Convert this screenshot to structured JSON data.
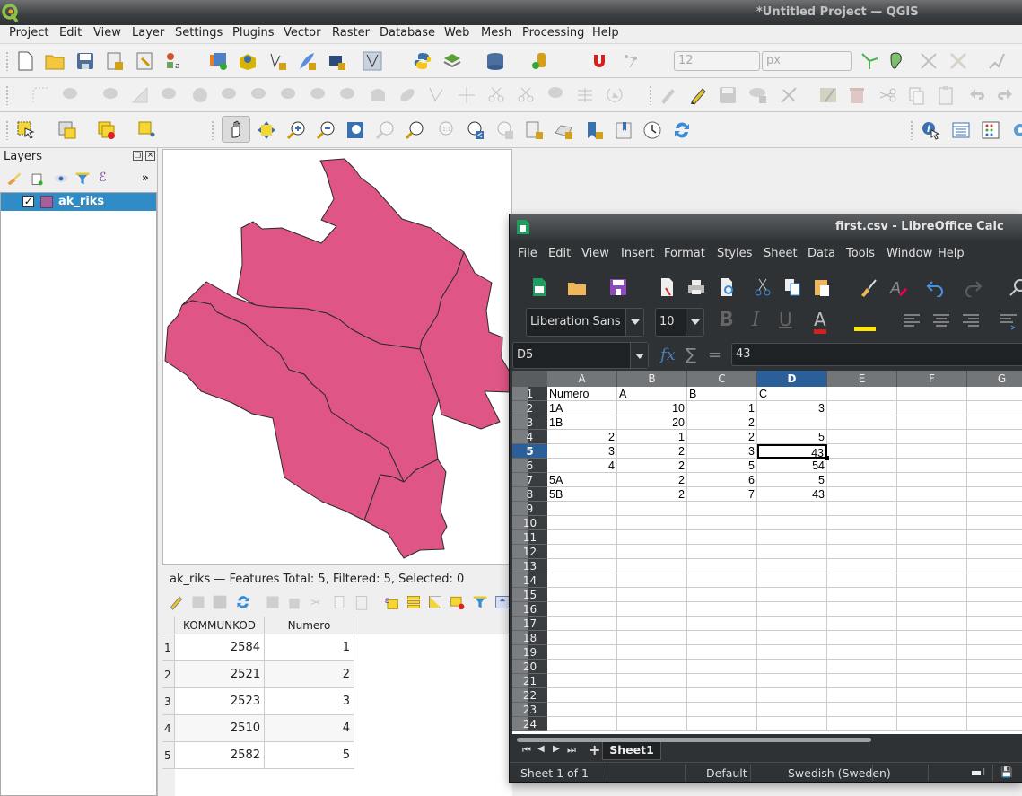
{
  "qgis": {
    "window_title": "*Untitled Project — QGIS",
    "menu": [
      "Project",
      "Edit",
      "View",
      "Layer",
      "Settings",
      "Plugins",
      "Vector",
      "Raster",
      "Database",
      "Web",
      "Mesh",
      "Processing",
      "Help"
    ],
    "toolbar": {
      "snap_tolerance_value": "12",
      "snap_unit": "px"
    },
    "layers_panel": {
      "title": "Layers",
      "expand_label": "»",
      "layers": [
        {
          "name": "ak_riks",
          "checked": true,
          "color": "#a6619b"
        }
      ]
    },
    "map": {
      "fill_color": "#df5686",
      "stroke_color": "#2b2b2b"
    },
    "attribute_table": {
      "title": "ak_riks — Features Total: 5, Filtered: 5, Selected: 0",
      "columns": [
        "KOMMUNKOD",
        "Numero"
      ],
      "rows": [
        {
          "id": "1",
          "KOMMUNKOD": "2584",
          "Numero": "1"
        },
        {
          "id": "2",
          "KOMMUNKOD": "2521",
          "Numero": "2"
        },
        {
          "id": "3",
          "KOMMUNKOD": "2523",
          "Numero": "3"
        },
        {
          "id": "4",
          "KOMMUNKOD": "2510",
          "Numero": "4"
        },
        {
          "id": "5",
          "KOMMUNKOD": "2582",
          "Numero": "5"
        }
      ]
    }
  },
  "calc": {
    "window_title": "first.csv - LibreOffice Calc",
    "menu": [
      "File",
      "Edit",
      "View",
      "Insert",
      "Format",
      "Styles",
      "Sheet",
      "Data",
      "Tools",
      "Window",
      "Help"
    ],
    "font_name": "Liberation Sans",
    "font_size": "10",
    "name_box": "D5",
    "formula": "43",
    "fx_label": "fx",
    "sum_label": "∑",
    "eq_label": "=",
    "columns": [
      "A",
      "B",
      "C",
      "D",
      "E",
      "F",
      "G"
    ],
    "selected_column": "D",
    "selected_row": "5",
    "row_numbers": [
      "1",
      "2",
      "3",
      "4",
      "5",
      "6",
      "7",
      "8",
      "9",
      "10",
      "11",
      "12",
      "13",
      "14",
      "15",
      "16",
      "17",
      "18",
      "19",
      "20",
      "21",
      "22",
      "23",
      "24"
    ],
    "cells": [
      [
        "Numero",
        "A",
        "B",
        "C"
      ],
      [
        "1A",
        "10",
        "1",
        "3"
      ],
      [
        "1B",
        "20",
        "2",
        ""
      ],
      [
        "2",
        "1",
        "2",
        "5"
      ],
      [
        "3",
        "2",
        "3",
        "43"
      ],
      [
        "4",
        "2",
        "5",
        "54"
      ],
      [
        "5A",
        "2",
        "6",
        "5"
      ],
      [
        "5B",
        "2",
        "7",
        "43"
      ]
    ],
    "sheet_tab": "Sheet1",
    "status": {
      "sheet": "Sheet 1 of 1",
      "style": "Default",
      "language": "Swedish (Sweden)"
    },
    "accent": "#2a5f9a"
  }
}
